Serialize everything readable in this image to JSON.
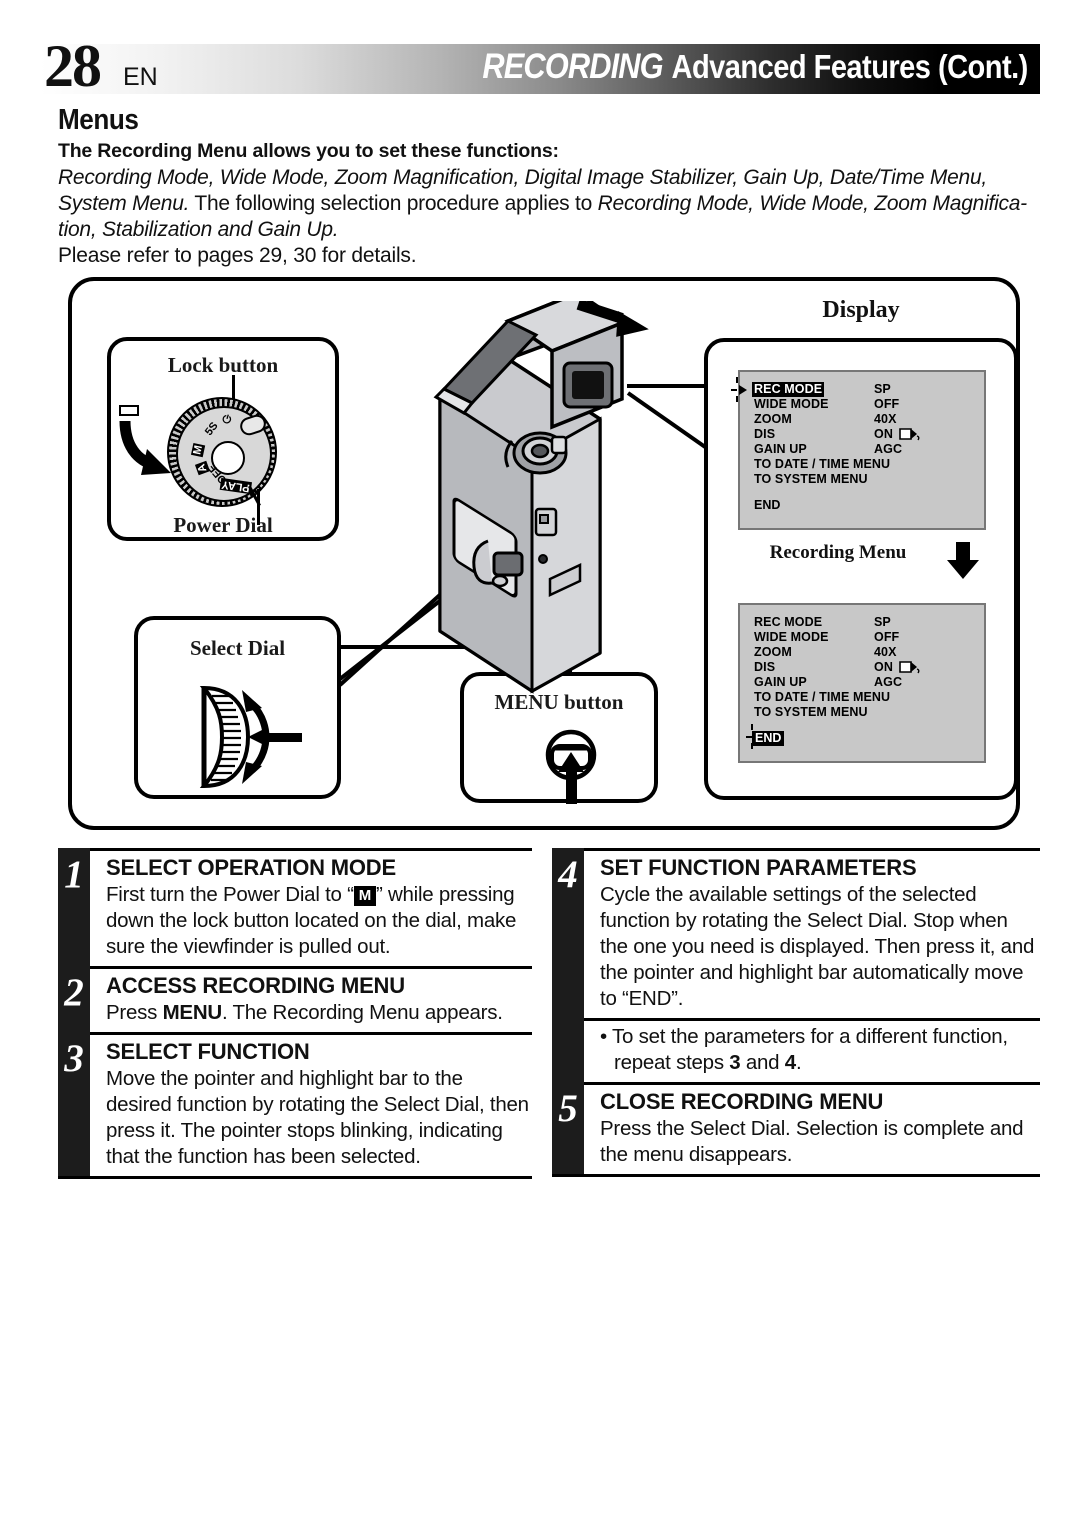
{
  "header": {
    "page_number": "28",
    "language": "EN",
    "title_italic": "RECORDING",
    "title_rest": "Advanced Features (Cont.)",
    "section_title": "Menus"
  },
  "intro": {
    "lead": "The Recording Menu allows you to set these functions:",
    "line1_italic": "Recording Mode, Wide Mode, Zoom Magnification, Digital Image Stabilizer, Gain Up, Date/Time Menu,",
    "line2_italic_a": "System Menu.",
    "line2_plain": " The following selection procedure applies to ",
    "line2_italic_b": "Recording Mode, Wide Mode, Zoom Magnifica-",
    "line3_italic": "tion, Stabilization and Gain Up.",
    "line4": "Please refer to pages 29, 30 for details."
  },
  "diagram": {
    "display_heading": "Display",
    "callouts": {
      "lock_button": "Lock button",
      "power_dial": "Power Dial",
      "select_dial": "Select Dial",
      "menu_button": "MENU button"
    },
    "dial_positions": [
      "5S",
      "M",
      "A",
      "OFF",
      "PLAY"
    ],
    "dial_power_icon": "power-icon",
    "recording_menu_label": "Recording Menu",
    "screens": [
      {
        "name": "recording-menu-initial",
        "highlight": "REC MODE",
        "rows": [
          {
            "label": "REC MODE",
            "value": "SP"
          },
          {
            "label": "WIDE MODE",
            "value": "OFF"
          },
          {
            "label": "ZOOM",
            "value": "40X"
          },
          {
            "label": "DIS",
            "value": "ON"
          },
          {
            "label": "GAIN UP",
            "value": "AGC"
          },
          {
            "label": "TO DATE / TIME MENU",
            "value": ""
          },
          {
            "label": "TO SYSTEM MENU",
            "value": ""
          }
        ],
        "end_label": "END",
        "end_highlighted": false
      },
      {
        "name": "recording-menu-end-selected",
        "highlight": "END",
        "rows": [
          {
            "label": "REC MODE",
            "value": "SP"
          },
          {
            "label": "WIDE MODE",
            "value": "OFF"
          },
          {
            "label": "ZOOM",
            "value": "40X"
          },
          {
            "label": "DIS",
            "value": "ON"
          },
          {
            "label": "GAIN UP",
            "value": "AGC"
          },
          {
            "label": "TO DATE / TIME MENU",
            "value": ""
          },
          {
            "label": "TO SYSTEM MENU",
            "value": ""
          }
        ],
        "end_label": "END",
        "end_highlighted": true
      }
    ]
  },
  "steps": [
    {
      "num": "1",
      "title": "SELECT OPERATION MODE",
      "body_pre": "First turn the Power Dial to “",
      "body_icon": "M",
      "body_post": "” while pressing down the lock button located on the dial, make sure the viewfinder is pulled out."
    },
    {
      "num": "2",
      "title": "ACCESS RECORDING MENU",
      "body_pre": "Press ",
      "body_bold": "MENU",
      "body_post": ". The Recording Menu appears."
    },
    {
      "num": "3",
      "title": "SELECT FUNCTION",
      "body": "Move the pointer and highlight bar to the desired function by rotating the Select Dial, then press it. The pointer stops blinking, indicating that the function has been selected."
    },
    {
      "num": "4",
      "title": "SET FUNCTION PARAMETERS",
      "body": "Cycle the available settings of the selected function by rotating the Select Dial. Stop when the one you need is displayed. Then press it, and the pointer and highlight bar automatically move to “END”."
    },
    {
      "num": "5",
      "title": "CLOSE RECORDING MENU",
      "body": "Press the Select Dial. Selection is complete and the menu disappears."
    }
  ],
  "note": {
    "text_pre": "• To set the parameters for a different function, repeat steps ",
    "step_a": "3",
    "text_mid": " and ",
    "step_b": "4",
    "text_post": "."
  }
}
